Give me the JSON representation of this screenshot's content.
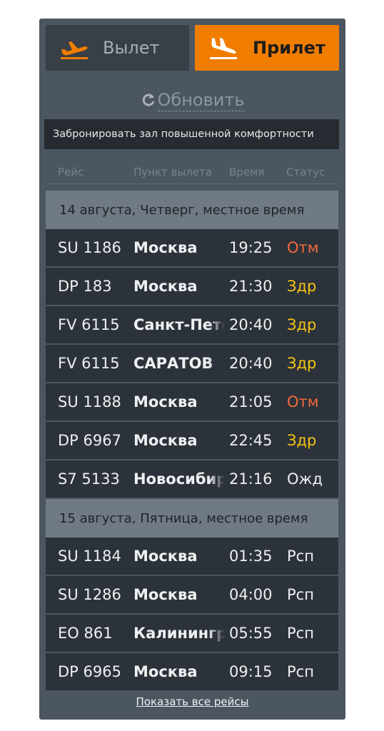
{
  "tabs": {
    "departure": {
      "label": "Вылет",
      "icon": "plane-takeoff-icon"
    },
    "arrival": {
      "label": "Прилет",
      "icon": "plane-landing-icon",
      "active": true
    }
  },
  "refresh": {
    "label": "Обновить",
    "icon": "refresh-icon"
  },
  "lounge_button": {
    "label": "Забронировать зал повышенной комфортности"
  },
  "table": {
    "columns": [
      "Рейс",
      "Пункт вылета",
      "Время",
      "Статус"
    ],
    "groups": [
      {
        "date": "14 августа, Четверг, местное время",
        "flights": [
          {
            "flight": "SU 1186",
            "city": "Москва",
            "time": "19:25",
            "status": "Отм"
          },
          {
            "flight": "DP 183",
            "city": "Москва",
            "time": "21:30",
            "status": "Здр"
          },
          {
            "flight": "FV 6115",
            "city": "Санкт-Петербург",
            "time": "20:40",
            "status": "Здр"
          },
          {
            "flight": "FV 6115",
            "city": "САРАТОВ",
            "time": "20:40",
            "status": "Здр"
          },
          {
            "flight": "SU 1188",
            "city": "Москва",
            "time": "21:05",
            "status": "Отм"
          },
          {
            "flight": "DP 6967",
            "city": "Москва",
            "time": "22:45",
            "status": "Здр"
          },
          {
            "flight": "S7 5133",
            "city": "Новосибирск",
            "time": "21:16",
            "status": "Ожд"
          }
        ]
      },
      {
        "date": "15 августа, Пятница, местное время",
        "flights": [
          {
            "flight": "SU 1184",
            "city": "Москва",
            "time": "01:35",
            "status": "Рсп"
          },
          {
            "flight": "SU 1286",
            "city": "Москва",
            "time": "04:00",
            "status": "Рсп"
          },
          {
            "flight": "EO 861",
            "city": "Калининград",
            "time": "05:55",
            "status": "Рсп"
          },
          {
            "flight": "DP 6965",
            "city": "Москва",
            "time": "09:15",
            "status": "Рсп"
          }
        ]
      }
    ]
  },
  "status_colors": {
    "Отм": "#f26a3c",
    "Здр": "#f5c414",
    "Ожд": "#eef0f1",
    "Рсп": "#eef0f1"
  },
  "colors": {
    "accent": "#f07d00",
    "panel": "#4b5661",
    "row": "#2c323a",
    "date_row": "#6f7a85"
  },
  "footer": {
    "show_all_label": "Показать все рейсы"
  }
}
